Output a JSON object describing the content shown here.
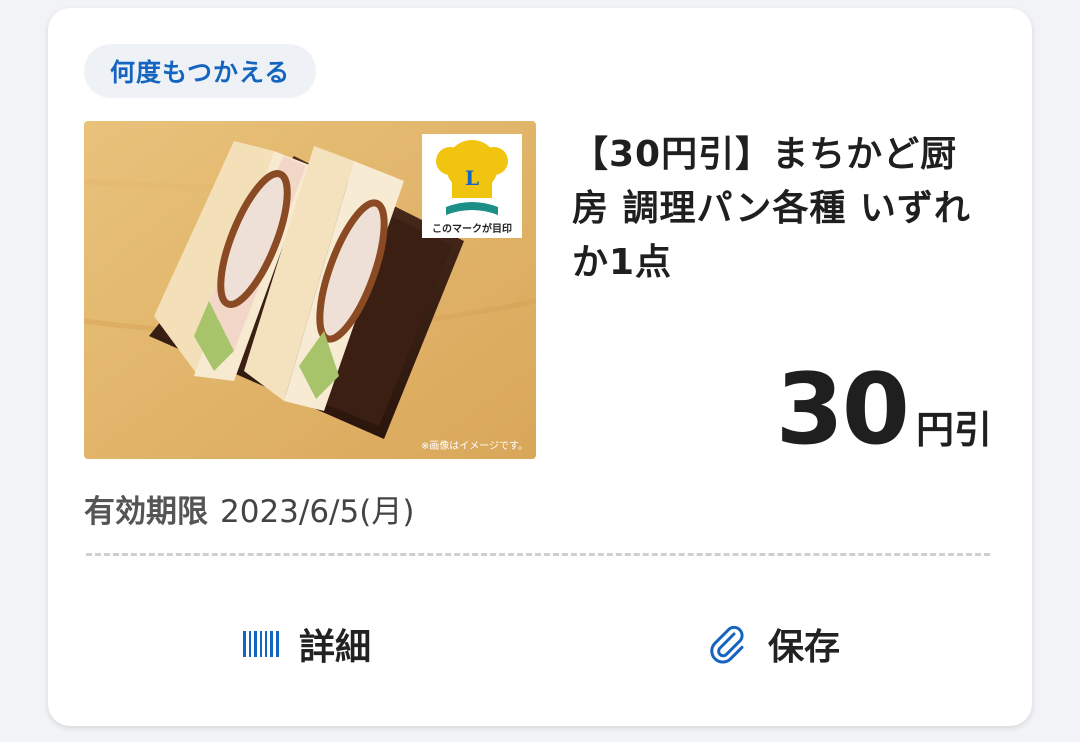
{
  "coupon": {
    "badge": "何度もつかえる",
    "title": "【30円引】まちかど厨房 調理パン各種 いずれか1点",
    "discount_amount": "30",
    "discount_unit": "円引",
    "expiry_label": "有効期限",
    "expiry_date": "2023/6/5(月)",
    "image": {
      "logo_letter": "L",
      "logo_caption": "このマークが目印",
      "note": "※画像はイメージです。"
    }
  },
  "actions": {
    "details_label": "詳細",
    "save_label": "保存"
  },
  "icons": {
    "details": "barcode-icon",
    "save": "paperclip-icon"
  },
  "colors": {
    "accent": "#1565c0",
    "badge_bg": "#eef2f7",
    "background": "#f1f3f6"
  }
}
